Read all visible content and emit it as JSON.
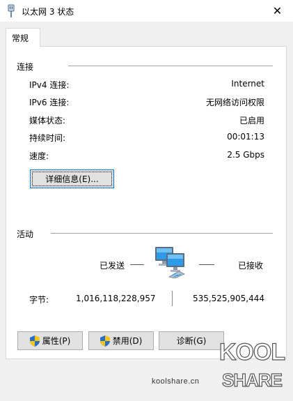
{
  "window": {
    "title": "以太网 3 状态",
    "close_glyph": "✕"
  },
  "tabs": [
    {
      "label": "常规"
    }
  ],
  "connection": {
    "section_label": "连接",
    "rows": [
      {
        "label": "IPv4 连接:",
        "value": "Internet"
      },
      {
        "label": "IPv6 连接:",
        "value": "无网络访问权限"
      },
      {
        "label": "媒体状态:",
        "value": "已启用"
      },
      {
        "label": "持续时间:",
        "value": "00:01:13"
      },
      {
        "label": "速度:",
        "value": "2.5 Gbps"
      }
    ],
    "details_button": "详细信息(E)..."
  },
  "activity": {
    "section_label": "活动",
    "sent_label": "已发送",
    "received_label": "已接收",
    "bytes_label": "字节:",
    "bytes_sent": "1,016,118,228,957",
    "bytes_received": "535,525,905,444"
  },
  "buttons": {
    "properties": "属性(P)",
    "disable": "禁用(D)",
    "diagnose": "诊断(G)"
  },
  "watermark": {
    "site": "koolshare.cn",
    "logo_line1": "KOOL",
    "logo_line2": "SHARE"
  },
  "icons": {
    "title": "network-adapter-icon",
    "activity": "network-computers-icon",
    "shield": "uac-shield-icon"
  }
}
